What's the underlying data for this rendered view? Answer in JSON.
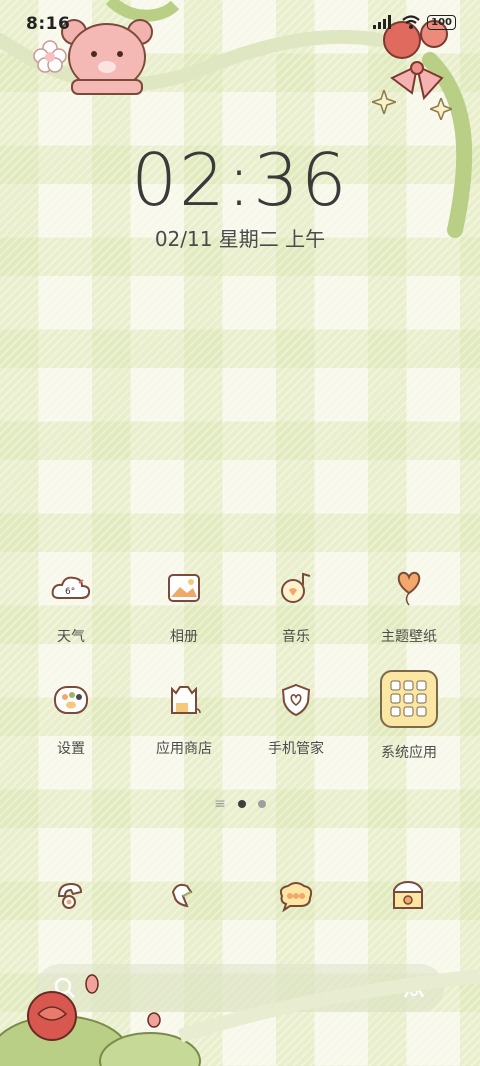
{
  "status_bar": {
    "time": "8:16",
    "battery": "100"
  },
  "lockscreen": {
    "clock": "02:36",
    "date": "02/11 星期二 上午"
  },
  "apps": [
    {
      "label": "天气",
      "icon": "weather-icon",
      "badge_text": "6°"
    },
    {
      "label": "相册",
      "icon": "photo-album-icon"
    },
    {
      "label": "音乐",
      "icon": "music-icon"
    },
    {
      "label": "主题壁纸",
      "icon": "heart-balloon-icon"
    },
    {
      "label": "设置",
      "icon": "paw-settings-icon"
    },
    {
      "label": "应用商店",
      "icon": "app-store-bag-icon"
    },
    {
      "label": "手机管家",
      "icon": "shield-heart-icon"
    },
    {
      "label": "系统应用",
      "icon": "folder-icon"
    }
  ],
  "page_indicator": {
    "pages": 2,
    "current": 1
  },
  "dock": [
    {
      "icon": "phone-icon"
    },
    {
      "icon": "browser-icon"
    },
    {
      "icon": "messages-icon"
    },
    {
      "icon": "camera-icon"
    }
  ],
  "colors": {
    "accent_green": "#cfe0a8",
    "pink": "#f4a9a8",
    "rose": "#d8574e"
  }
}
